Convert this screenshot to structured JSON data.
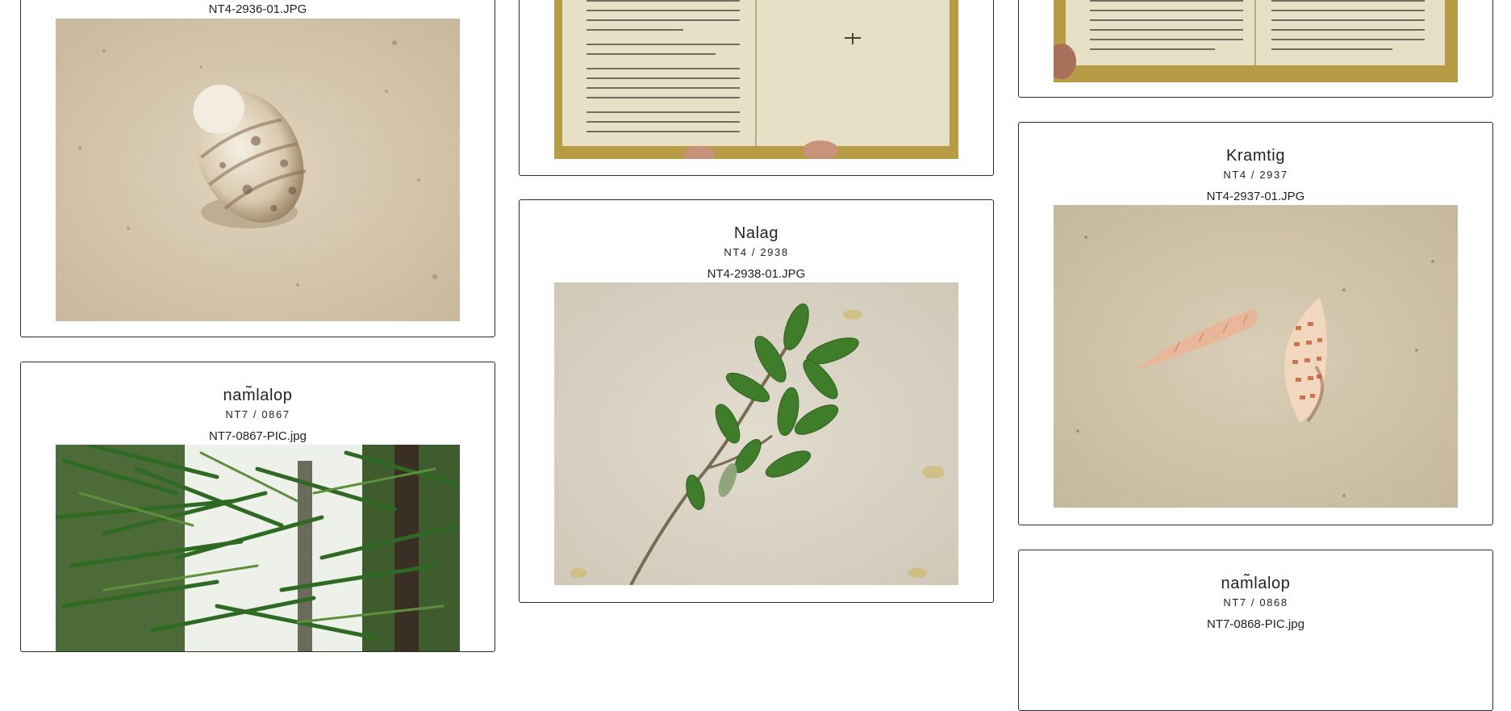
{
  "cards": [
    {
      "filename": "NT4-2936-01.JPG",
      "image": "shell-photo"
    },
    {
      "image": "open-book-photo"
    },
    {
      "image": "open-book-photo"
    },
    {
      "title": "Nalag",
      "code": "NT4 / 2938",
      "filename": "NT4-2938-01.JPG",
      "image": "mangrove-leaves-photo"
    },
    {
      "title": "Kramtig",
      "code": "NT4 / 2937",
      "filename": "NT4-2937-01.JPG",
      "image": "two-shells-photo"
    },
    {
      "title": "nam̃lalop",
      "code": "NT7 / 0867",
      "filename": "NT7-0867-PIC.jpg",
      "image": "bamboo-photo"
    },
    {
      "title": "nam̃lalop",
      "code": "NT7 / 0868",
      "filename": "NT7-0868-PIC.jpg"
    }
  ]
}
